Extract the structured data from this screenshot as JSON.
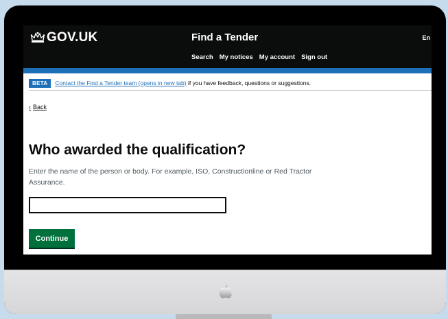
{
  "header": {
    "brand": "GOV.UK",
    "service_name": "Find a Tender",
    "language_link": "En",
    "nav": [
      "Search",
      "My notices",
      "My account",
      "Sign out"
    ]
  },
  "beta_banner": {
    "tag": "BETA",
    "link_text": "Contact the Find a Tender team (opens in new tab)",
    "text": "if you have feedback, questions or suggestions."
  },
  "back_link": "Back",
  "question": {
    "heading": "Who awarded the qualification?",
    "hint": "Enter the name of the person or body. For example, ISO, Constructionline or Red Tractor Assurance.",
    "input_value": ""
  },
  "continue_button": "Continue",
  "colors": {
    "header_bg": "#0b0c0c",
    "accent_blue": "#1d70b8",
    "button_green": "#00703c",
    "page_bg": "#c6dbec"
  },
  "icons": [
    "crown-icon",
    "apple-logo-icon"
  ]
}
